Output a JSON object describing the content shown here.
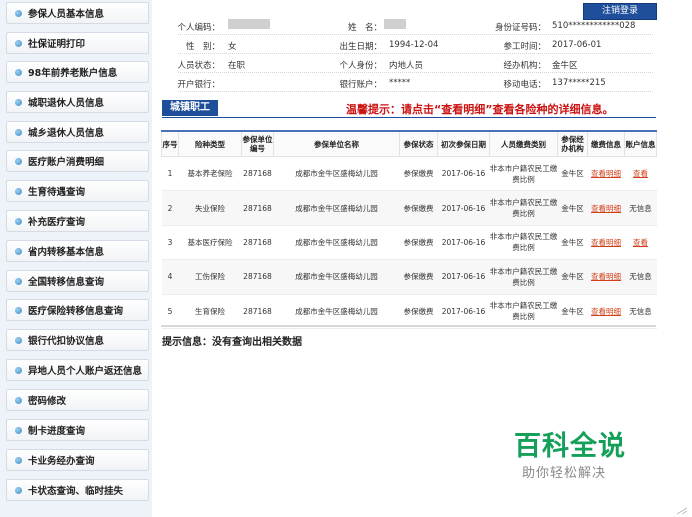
{
  "sidebar": {
    "items": [
      {
        "label": "参保人员基本信息"
      },
      {
        "label": "社保证明打印"
      },
      {
        "label": "98年前养老账户信息"
      },
      {
        "label": "城职退休人员信息"
      },
      {
        "label": "城乡退休人员信息"
      },
      {
        "label": "医疗账户消费明细"
      },
      {
        "label": "生育待遇查询"
      },
      {
        "label": "补充医疗查询"
      },
      {
        "label": "省内转移基本信息"
      },
      {
        "label": "全国转移信息查询"
      },
      {
        "label": "医疗保险转移信息查询"
      },
      {
        "label": "银行代扣协议信息"
      },
      {
        "label": "异地人员个人账户返还信息"
      },
      {
        "label": "密码修改"
      },
      {
        "label": "制卡进度查询"
      },
      {
        "label": "卡业务经办查询"
      },
      {
        "label": "卡状态查询、临时挂失"
      }
    ]
  },
  "header": {
    "logout_label": "注销登录"
  },
  "person": {
    "code_label": "个人编码：",
    "name_label": "姓　名：",
    "id_label": "身份证号码：",
    "id_value": "510************028",
    "gender_label": "性　别：",
    "gender_value": "女",
    "birth_label": "出生日期：",
    "birth_value": "1994-12-04",
    "work_label": "参工时间：",
    "work_value": "2017-06-01",
    "status_label": "人员状态：",
    "status_value": "在职",
    "identity_label": "个人身份：",
    "identity_value": "内地人员",
    "agency_label": "经办机构：",
    "agency_value": "金牛区",
    "bank_label": "开户银行：",
    "account_label": "银行账户：",
    "account_value": "*****",
    "phone_label": "移动电话：",
    "phone_value": "137*****215"
  },
  "section": {
    "title": "城镇职工",
    "tip": "温馨提示：请点击“查看明细”查看各险种的详细信息。"
  },
  "table": {
    "headers": [
      "序号",
      "险种类型",
      "参保单位编号",
      "参保单位名称",
      "参保状态",
      "初次参保日期",
      "人员缴费类别",
      "参保经办机构",
      "缴费信息",
      "账户信息"
    ],
    "rows": [
      {
        "no": "1",
        "type": "基本养老保险",
        "unit_no": "287168",
        "unit_name": "成都市金牛区盛梅幼儿园",
        "status": "参保缴费",
        "date": "2017-06-16",
        "cat": "非本市户籍农民工缴费比例",
        "agency": "金牛区",
        "pay": "查看明细",
        "acct": "查看",
        "acct_link": true
      },
      {
        "no": "2",
        "type": "失业保险",
        "unit_no": "287168",
        "unit_name": "成都市金牛区盛梅幼儿园",
        "status": "参保缴费",
        "date": "2017-06-16",
        "cat": "非本市户籍农民工缴费比例",
        "agency": "金牛区",
        "pay": "查看明细",
        "acct": "无信息",
        "acct_link": false
      },
      {
        "no": "3",
        "type": "基本医疗保险",
        "unit_no": "287168",
        "unit_name": "成都市金牛区盛梅幼儿园",
        "status": "参保缴费",
        "date": "2017-06-16",
        "cat": "非本市户籍农民工缴费比例",
        "agency": "金牛区",
        "pay": "查看明细",
        "acct": "查看",
        "acct_link": true
      },
      {
        "no": "4",
        "type": "工伤保险",
        "unit_no": "287168",
        "unit_name": "成都市金牛区盛梅幼儿园",
        "status": "参保缴费",
        "date": "2017-06-16",
        "cat": "非本市户籍农民工缴费比例",
        "agency": "金牛区",
        "pay": "查看明细",
        "acct": "无信息",
        "acct_link": false
      },
      {
        "no": "5",
        "type": "生育保险",
        "unit_no": "287168",
        "unit_name": "成都市金牛区盛梅幼儿园",
        "status": "参保缴费",
        "date": "2017-06-16",
        "cat": "非本市户籍农民工缴费比例",
        "agency": "金牛区",
        "pay": "查看明细",
        "acct": "无信息",
        "acct_link": false
      }
    ]
  },
  "hint": "提示信息：没有查询出相关数据",
  "watermark": {
    "brand": "百科全说",
    "slogan": "助你轻松解决"
  },
  "colors": {
    "header_blue": "#1f4f9a",
    "tip_red": "#cc1111",
    "link_red": "#d2401a",
    "watermark_green": "#15a05a"
  }
}
